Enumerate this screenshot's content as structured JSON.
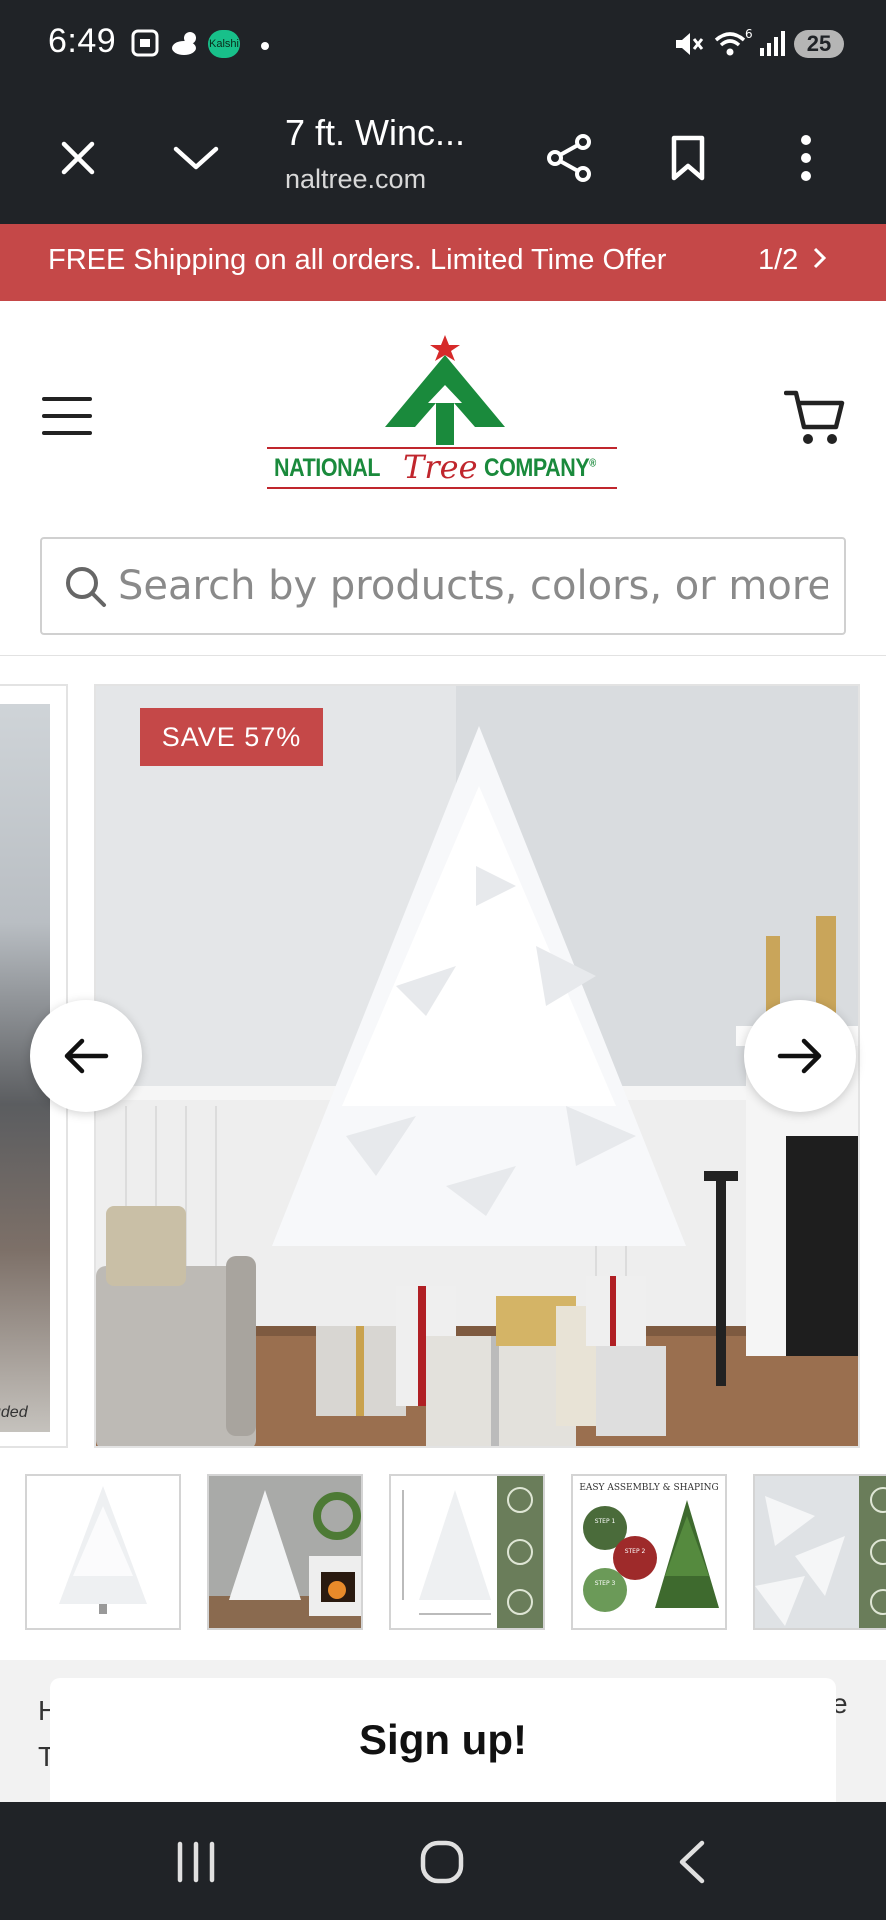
{
  "status_bar": {
    "time": "6:49",
    "kalshi_badge": "Kalshi",
    "battery": "25",
    "signal_superscript": "6",
    "icons": [
      "screenshot-icon",
      "weather-icon",
      "kalshi-icon",
      "dot-icon",
      "mute-icon",
      "wifi-icon",
      "signal-icon",
      "battery-icon"
    ]
  },
  "browser": {
    "page_title": "7 ft. Winc...",
    "url": "naltree.com",
    "icons": [
      "close-icon",
      "chevron-down-icon",
      "share-icon",
      "bookmark-icon",
      "more-vert-icon"
    ]
  },
  "promo": {
    "text": "FREE Shipping on all orders. Limited Time Offer",
    "pager": "1/2"
  },
  "header": {
    "logo": {
      "left": "NATIONAL",
      "middle": "Tree",
      "right": "COMPANY",
      "registered": "®"
    },
    "search_placeholder": "Search by products, colors, or more"
  },
  "carousel": {
    "badge": "SAVE 57%",
    "prev_caption": "uded"
  },
  "thumbnails": {
    "assembly_title": "EASY ASSEMBLY & SHAPING",
    "step1": "STEP 1",
    "step2": "STEP 2",
    "step3": "STEP 3"
  },
  "below": {
    "peek_left_1": "H",
    "peek_left_2": "T",
    "peek_right": "e",
    "signup": "Sign up!"
  },
  "colors": {
    "system_bar": "#202327",
    "promo_red": "#c54848",
    "brand_green": "#1a8a3c",
    "brand_red": "#c0262d"
  }
}
